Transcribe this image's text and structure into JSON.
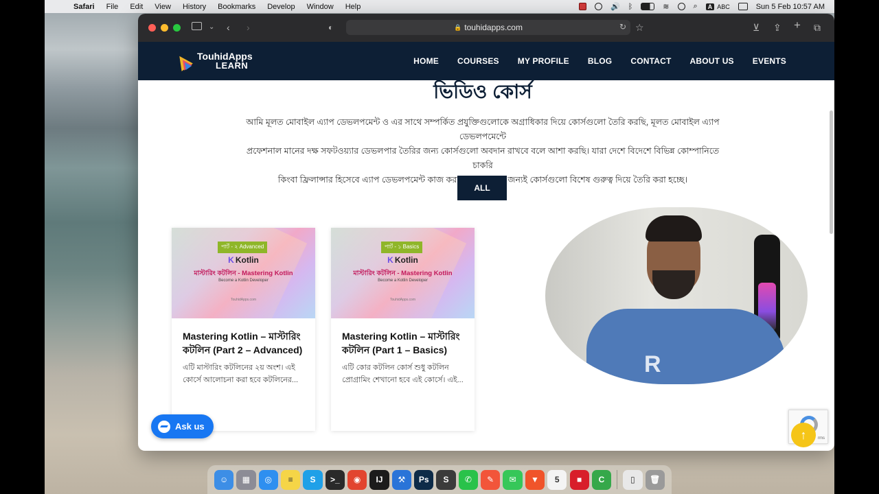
{
  "menubar": {
    "app_name": "Safari",
    "items": [
      "File",
      "Edit",
      "View",
      "History",
      "Bookmarks",
      "Develop",
      "Window",
      "Help"
    ],
    "input_source": "A",
    "input_label": "ABC",
    "clock": "Sun 5 Feb  10:57 AM"
  },
  "browser": {
    "url": "touhidapps.com"
  },
  "site": {
    "logo_line1": "TouhidApps",
    "logo_line2": "LEARN",
    "nav": [
      "HOME",
      "COURSES",
      "MY PROFILE",
      "BLOG",
      "CONTACT",
      "ABOUT US",
      "EVENTS"
    ],
    "heading": "ভিডিও কোর্স",
    "description_lines": [
      "আমি মূলত মোবাইল এ্যাপ ডেভলপমেন্ট ও এর সাথে সম্পর্কিত প্রযুক্তিগুলোকে অগ্রাধিকার দিয়ে কোর্সগুলো তৈরি করছি, মূলত মোবাইল এ্যাপ ডেভলপমেন্টে",
      "প্রফেশনাল মানের দক্ষ সফটওয়্যার ডেভলপার তৈরির জন্য কোর্সগুলো অবদান রাখবে বলে আশা করছি। যারা দেশে বিদেশে বিভিন্ন কোম্পানিতে চাকরি",
      "কিংবা ফ্রিলান্সার হিসেবে এ্যাপ ডেভলপমেন্ট কাজ করতে চান তাদের জন্যই কোর্সগুলো বিশেষ গুরুত্ব দিয়ে তৈরি করা হচ্ছে।"
    ],
    "filter_all": "ALL",
    "cards": [
      {
        "tag": "পার্ট - ২ Advanced",
        "logo": "Kotlin",
        "thumb_title": "মাস্টারিং কটলিন - Mastering Kotlin",
        "thumb_sub": "Become a Kotlin Developer",
        "thumb_foot": "TouhidApps.com",
        "title": "Mastering Kotlin – মাস্টারিং কটলিন (Part 2 – Advanced)",
        "excerpt": "এটি মাস্টারিং কটলিনের ২য় অংশ। এই কোর্সে আলোচনা করা হবে কটলিনের..."
      },
      {
        "tag": "পার্ট - ১ Basics",
        "logo": "Kotlin",
        "thumb_title": "মাস্টারিং কটলিন - Mastering Kotlin",
        "thumb_sub": "Become a Kotlin Developer",
        "thumb_foot": "TouhidApps.com",
        "title": "Mastering Kotlin – মাস্টারিং কটলিন (Part 1 – Basics)",
        "excerpt": "এটি কোর কটলিন কোর্স শুধু কটলিন প্রোগ্রামিং শেখানো হবে এই কোর্সে। এই..."
      }
    ],
    "video_shirt_text": "R",
    "ask_us": "Ask us",
    "recaptcha_text": "rms"
  },
  "dock": {
    "apps": [
      {
        "name": "finder-icon",
        "glyph": "☺",
        "color": "#3d8ee6"
      },
      {
        "name": "launchpad-icon",
        "glyph": "▦",
        "color": "#8c8c96"
      },
      {
        "name": "safari-icon",
        "glyph": "◎",
        "color": "#2e8ff0"
      },
      {
        "name": "notes-icon",
        "glyph": "≡",
        "color": "#f5d547"
      },
      {
        "name": "skype-icon",
        "glyph": "S",
        "color": "#1fa0e8"
      },
      {
        "name": "terminal-icon",
        "glyph": ">_",
        "color": "#2a2a2a"
      },
      {
        "name": "chrome-icon",
        "glyph": "◉",
        "color": "#e2452f"
      },
      {
        "name": "intellij-icon",
        "glyph": "IJ",
        "color": "#1b1b1b"
      },
      {
        "name": "xcode-icon",
        "glyph": "⚒",
        "color": "#2a74d8"
      },
      {
        "name": "photoshop-icon",
        "glyph": "Ps",
        "color": "#0d2b48"
      },
      {
        "name": "sublime-icon",
        "glyph": "S",
        "color": "#3b3b3b"
      },
      {
        "name": "whatsapp-icon",
        "glyph": "✆",
        "color": "#29c24a"
      },
      {
        "name": "pen-app-icon",
        "glyph": "✎",
        "color": "#f2553a"
      },
      {
        "name": "messages-icon",
        "glyph": "✉",
        "color": "#36c759"
      },
      {
        "name": "brave-icon",
        "glyph": "▼",
        "color": "#f0542a"
      },
      {
        "name": "calendar-icon",
        "glyph": "5",
        "color": "#f4f4f4"
      },
      {
        "name": "screen-record-icon",
        "glyph": "■",
        "color": "#d81e2a"
      },
      {
        "name": "camtasia-icon",
        "glyph": "C",
        "color": "#35a84a"
      },
      {
        "name": "document-icon",
        "glyph": "▯",
        "color": "#e8e8e8"
      },
      {
        "name": "trash-icon",
        "glyph": "🗑",
        "color": "#9a9a9a"
      }
    ]
  }
}
